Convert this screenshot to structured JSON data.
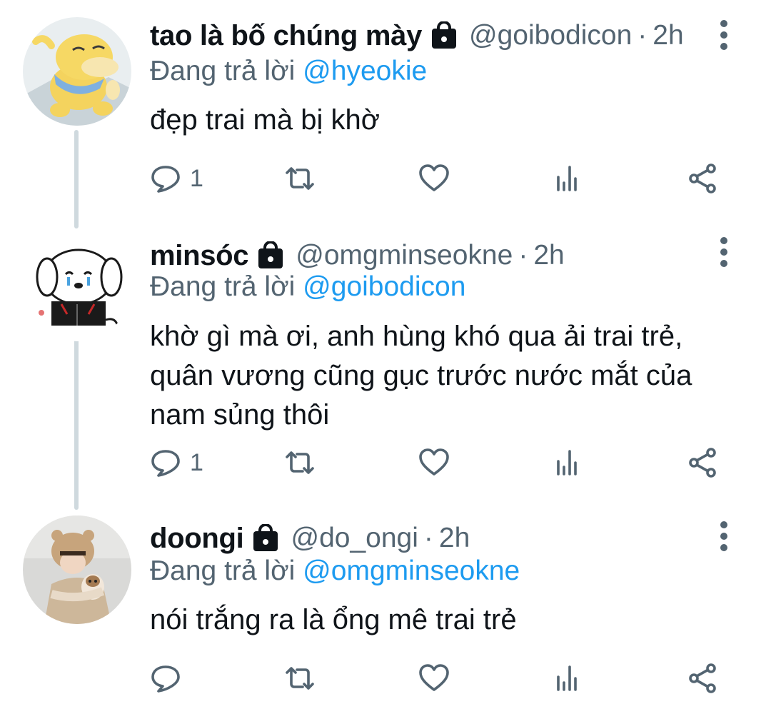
{
  "reply_prefix": "Đang trả lời",
  "tweets": [
    {
      "display_name": "tao là bố chúng mày",
      "handle": "@goibodicon",
      "separator": "·",
      "time": "2h",
      "reply_to": "@hyeokie",
      "text": "đẹp trai mà bị khờ",
      "reply_count": "1",
      "avatar": "psyduck-avatar"
    },
    {
      "display_name": "minsóc",
      "handle": "@omgminseokne",
      "separator": "·",
      "time": "2h",
      "reply_to": "@goibodicon",
      "text": "khờ gì mà ơi, anh hùng khó qua ải trai trẻ, quân vương cũng gục trước nước mắt của nam sủng thôi",
      "reply_count": "1",
      "avatar": "crying-puppy-avatar"
    },
    {
      "display_name": "doongi",
      "handle": "@do_ongi",
      "separator": "·",
      "time": "2h",
      "reply_to": "@omgminseokne",
      "text": "nói trắng ra là ổng mê trai trẻ",
      "reply_count": "",
      "avatar": "person-with-dog-avatar"
    }
  ],
  "colors": {
    "text": "#0f1419",
    "secondary": "#536471",
    "link": "#1d9bf0",
    "thread_line": "#cfd9de"
  }
}
